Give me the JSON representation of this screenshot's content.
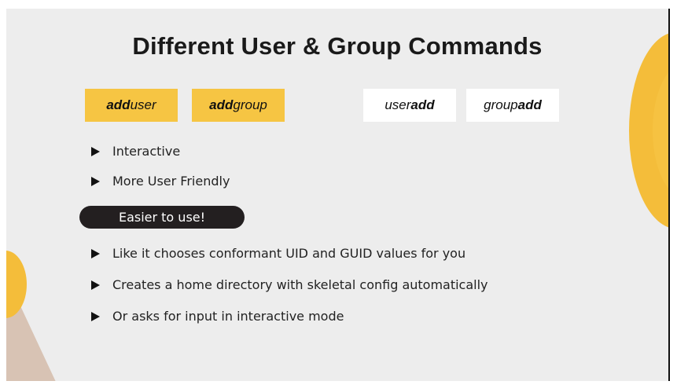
{
  "title": "Different User & Group Commands",
  "commands": [
    {
      "bold": "add",
      "rest": "user",
      "style": "gold",
      "color": "#f6c543"
    },
    {
      "bold": "add",
      "rest": "group",
      "style": "gold",
      "color": "#f6c543"
    },
    {
      "pre": "user",
      "bold": "add",
      "style": "white",
      "color": "#ffffff"
    },
    {
      "pre": "group",
      "bold": "add",
      "style": "white",
      "color": "#ffffff"
    }
  ],
  "bullets_top": [
    "Interactive",
    "More User Friendly"
  ],
  "pill": "Easier to use!",
  "bullets_bottom": [
    "Like it chooses conformant UID and GUID values for you",
    "Creates a home directory with skeletal config automatically",
    "Or asks for input in interactive mode"
  ]
}
